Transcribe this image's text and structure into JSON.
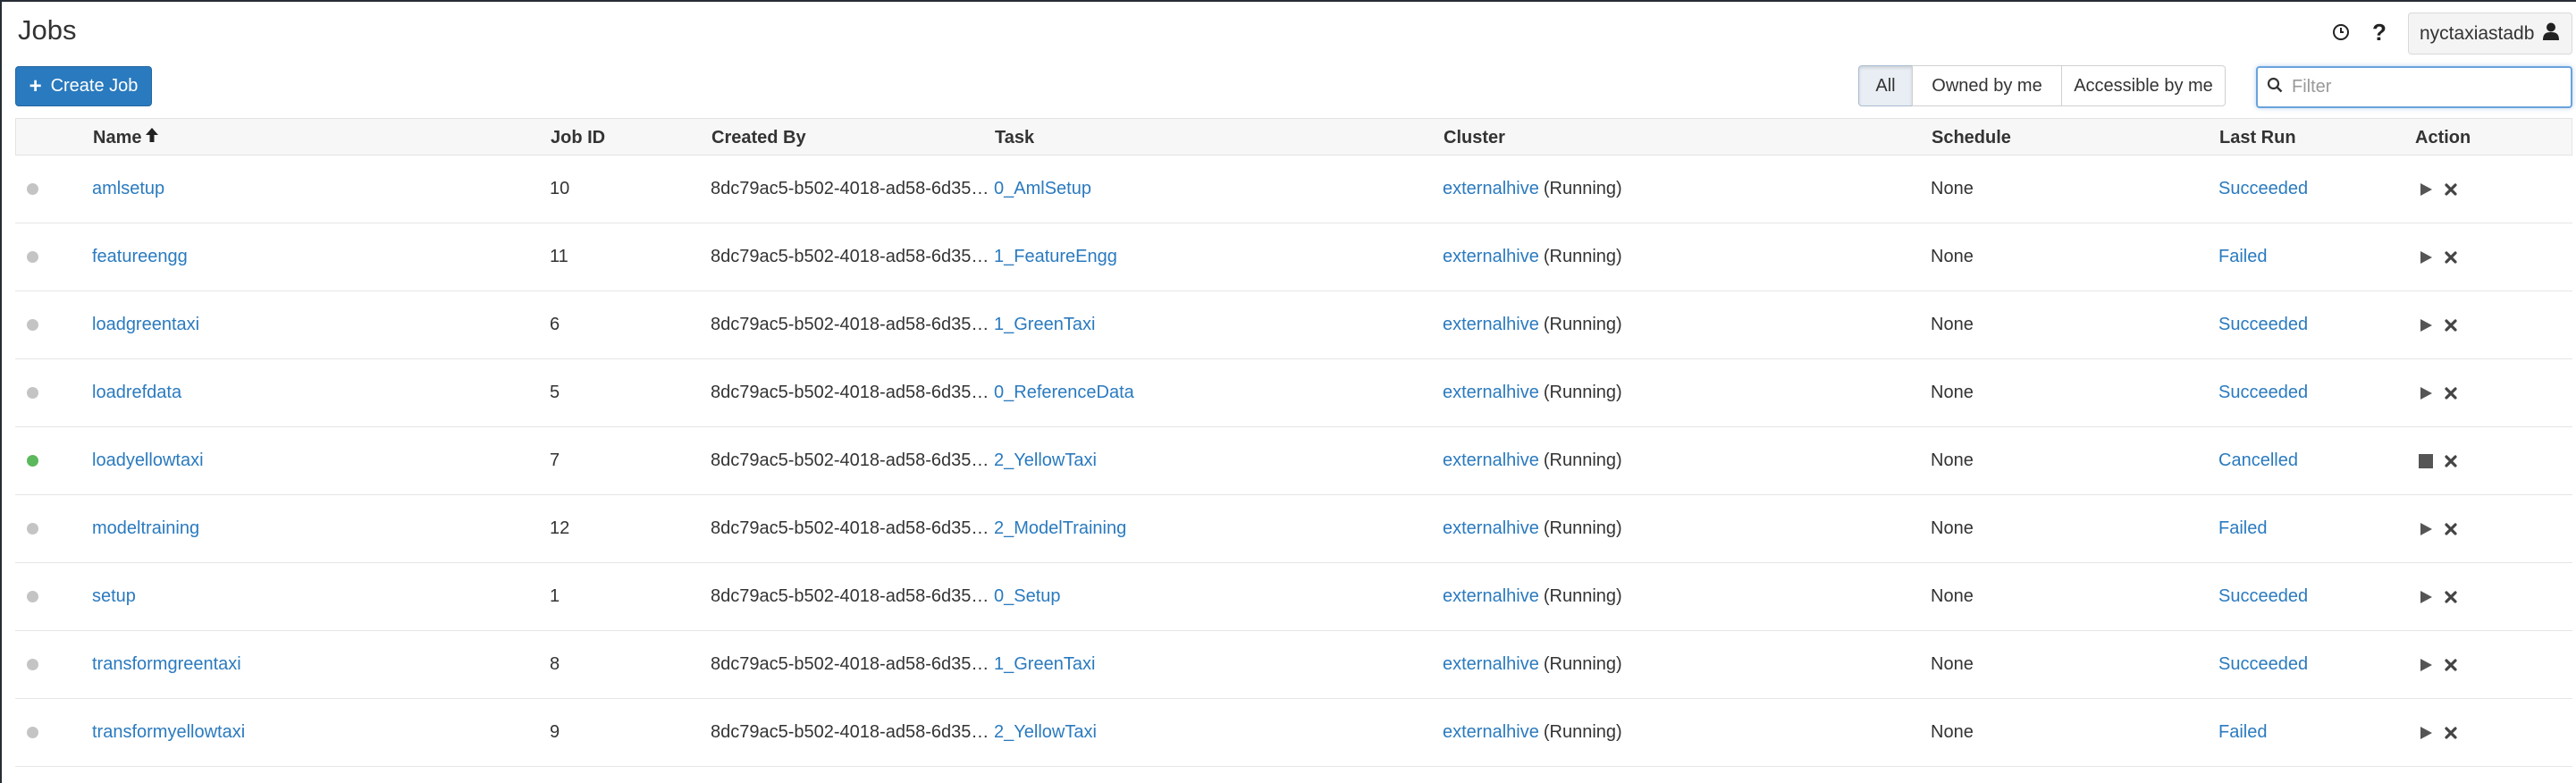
{
  "page": {
    "title": "Jobs"
  },
  "header": {
    "username": "nyctaxiastadb"
  },
  "toolbar": {
    "create_job_label": "Create Job",
    "filters": [
      "All",
      "Owned by me",
      "Accessible by me"
    ],
    "active_filter": "All",
    "filter_placeholder": "Filter"
  },
  "table": {
    "columns": {
      "name": "Name",
      "job_id": "Job ID",
      "created_by": "Created By",
      "task": "Task",
      "cluster": "Cluster",
      "schedule": "Schedule",
      "last_run": "Last Run",
      "action": "Action"
    },
    "rows": [
      {
        "status": "idle",
        "name": "amlsetup",
        "job_id": "10",
        "created_by": "8dc79ac5-b502-4018-ad58-6d35…",
        "task": "0_AmlSetup",
        "cluster": "externalhive",
        "cluster_state": "(Running)",
        "schedule": "None",
        "last_run": "Succeeded",
        "primary_action": "run"
      },
      {
        "status": "idle",
        "name": "featureengg",
        "job_id": "11",
        "created_by": "8dc79ac5-b502-4018-ad58-6d35…",
        "task": "1_FeatureEngg",
        "cluster": "externalhive",
        "cluster_state": "(Running)",
        "schedule": "None",
        "last_run": "Failed",
        "primary_action": "run"
      },
      {
        "status": "idle",
        "name": "loadgreentaxi",
        "job_id": "6",
        "created_by": "8dc79ac5-b502-4018-ad58-6d35…",
        "task": "1_GreenTaxi",
        "cluster": "externalhive",
        "cluster_state": "(Running)",
        "schedule": "None",
        "last_run": "Succeeded",
        "primary_action": "run"
      },
      {
        "status": "idle",
        "name": "loadrefdata",
        "job_id": "5",
        "created_by": "8dc79ac5-b502-4018-ad58-6d35…",
        "task": "0_ReferenceData",
        "cluster": "externalhive",
        "cluster_state": "(Running)",
        "schedule": "None",
        "last_run": "Succeeded",
        "primary_action": "run"
      },
      {
        "status": "running",
        "name": "loadyellowtaxi",
        "job_id": "7",
        "created_by": "8dc79ac5-b502-4018-ad58-6d35…",
        "task": "2_YellowTaxi",
        "cluster": "externalhive",
        "cluster_state": "(Running)",
        "schedule": "None",
        "last_run": "Cancelled",
        "primary_action": "stop"
      },
      {
        "status": "idle",
        "name": "modeltraining",
        "job_id": "12",
        "created_by": "8dc79ac5-b502-4018-ad58-6d35…",
        "task": "2_ModelTraining",
        "cluster": "externalhive",
        "cluster_state": "(Running)",
        "schedule": "None",
        "last_run": "Failed",
        "primary_action": "run"
      },
      {
        "status": "idle",
        "name": "setup",
        "job_id": "1",
        "created_by": "8dc79ac5-b502-4018-ad58-6d35…",
        "task": "0_Setup",
        "cluster": "externalhive",
        "cluster_state": "(Running)",
        "schedule": "None",
        "last_run": "Succeeded",
        "primary_action": "run"
      },
      {
        "status": "idle",
        "name": "transformgreentaxi",
        "job_id": "8",
        "created_by": "8dc79ac5-b502-4018-ad58-6d35…",
        "task": "1_GreenTaxi",
        "cluster": "externalhive",
        "cluster_state": "(Running)",
        "schedule": "None",
        "last_run": "Succeeded",
        "primary_action": "run"
      },
      {
        "status": "idle",
        "name": "transformyellowtaxi",
        "job_id": "9",
        "created_by": "8dc79ac5-b502-4018-ad58-6d35…",
        "task": "2_YellowTaxi",
        "cluster": "externalhive",
        "cluster_state": "(Running)",
        "schedule": "None",
        "last_run": "Failed",
        "primary_action": "run"
      }
    ]
  },
  "colors": {
    "link": "#2a7abf",
    "status_idle": "#c4c4c4",
    "status_running": "#5cb85c",
    "primary_button": "#2a7abf"
  },
  "icons": {
    "sort": "arrow-up-icon",
    "clock": "clock-icon",
    "help": "question-icon",
    "user": "user-icon",
    "search": "search-icon",
    "run": "play-icon",
    "stop": "stop-icon",
    "delete": "close-icon"
  }
}
